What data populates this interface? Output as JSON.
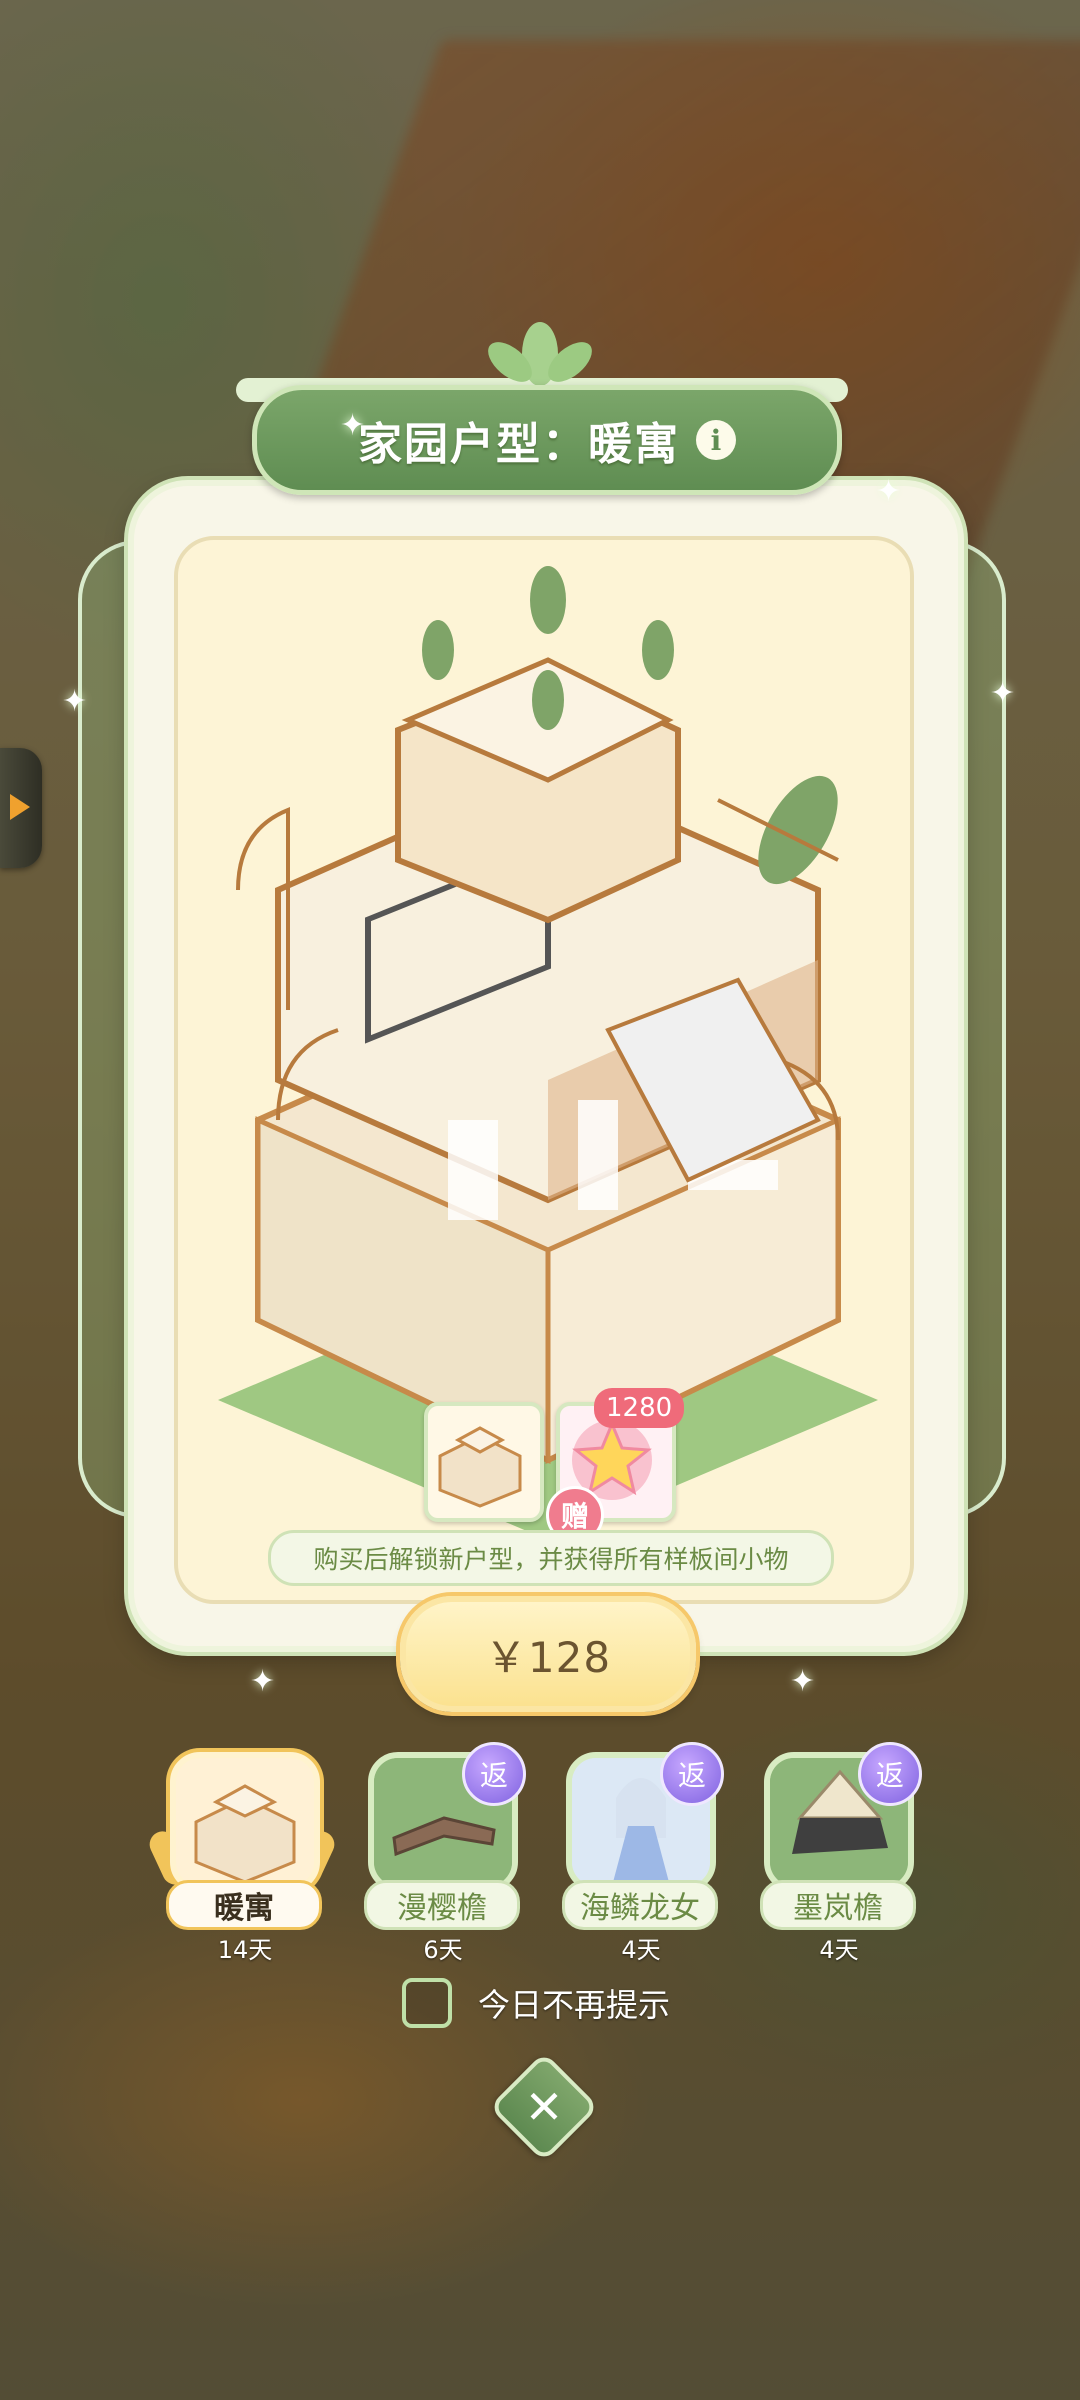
{
  "dialog": {
    "title": "家园户型：暖寓",
    "description": "购买后解锁新户型，并获得所有样板间小物",
    "bonus_count": "1280",
    "gift_label": "赠",
    "price": "￥128"
  },
  "options": [
    {
      "name": "暖寓",
      "days": "14天",
      "selected": true
    },
    {
      "name": "漫樱檐",
      "days": "6天",
      "badge": "返"
    },
    {
      "name": "海鳞龙女",
      "days": "4天",
      "badge": "返"
    },
    {
      "name": "墨岚檐",
      "days": "4天",
      "badge": "返"
    }
  ],
  "checkbox": {
    "label": "今日不再提示",
    "checked": false
  },
  "colors": {
    "accent_green": "#5f8d52",
    "price_gold": "#f6c86a",
    "pink_badge": "#ef6b7a",
    "return_purple": "#7f62e0"
  },
  "icons": [
    "info-icon",
    "close-icon",
    "star-icon",
    "arrow-right-icon",
    "leaf-icon",
    "sparkle-icon"
  ]
}
